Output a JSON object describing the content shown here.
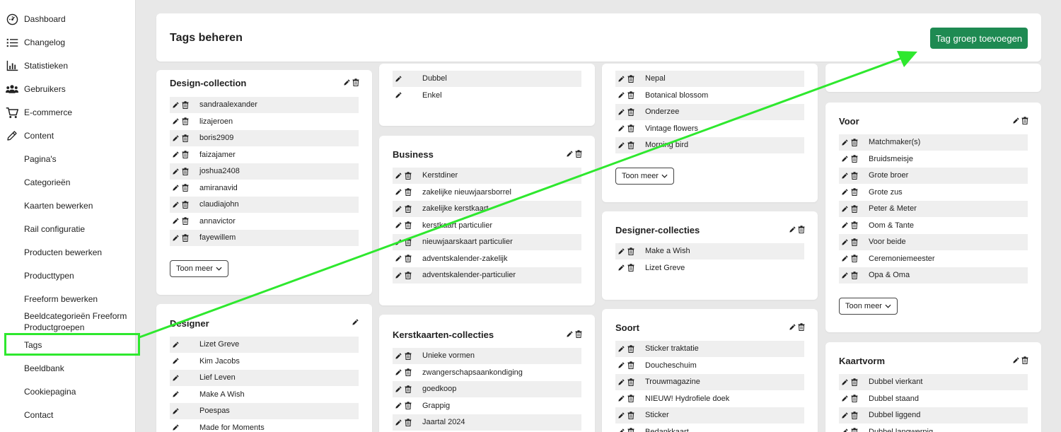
{
  "sidebar": {
    "items": [
      {
        "label": "Dashboard",
        "icon": "dashboard-icon"
      },
      {
        "label": "Changelog",
        "icon": "list-icon"
      },
      {
        "label": "Statistieken",
        "icon": "bar-chart-icon"
      },
      {
        "label": "Gebruikers",
        "icon": "users-icon"
      },
      {
        "label": "E-commerce",
        "icon": "cart-icon"
      },
      {
        "label": "Content",
        "icon": "pencil-icon"
      },
      {
        "label": "Pagina's"
      },
      {
        "label": "Categorieën"
      },
      {
        "label": "Kaarten bewerken"
      },
      {
        "label": "Rail configuratie"
      },
      {
        "label": "Producten bewerken"
      },
      {
        "label": "Producttypen"
      },
      {
        "label": "Freeform bewerken"
      },
      {
        "label": "Beeldcategorieën Freeform Productgroepen"
      },
      {
        "label": "Tags"
      },
      {
        "label": "Beeldbank"
      },
      {
        "label": "Cookiepagina"
      },
      {
        "label": "Contact"
      }
    ]
  },
  "header": {
    "title": "Tags beheren",
    "add_label": "Tag groep toevoegen"
  },
  "colors": {
    "accent": "#1e8a52",
    "highlight": "#2ee82e"
  },
  "cards": {
    "design_collection": {
      "title": "Design-collection",
      "items": [
        "sandraalexander",
        "lizajeroen",
        "boris2909",
        "faizajamer",
        "joshua2408",
        "amiranavid",
        "claudiajohn",
        "annavictor",
        "fayewillem"
      ],
      "more": "Toon meer"
    },
    "designer": {
      "title": "Designer",
      "items": [
        "Lizet Greve",
        "Kim Jacobs",
        "Lief Leven",
        "Make A Wish",
        "Poespas",
        "Made for Moments"
      ]
    },
    "col2_top": {
      "items": [
        "Dubbel",
        "Enkel"
      ]
    },
    "business": {
      "title": "Business",
      "items": [
        "Kerstdiner",
        "zakelijke nieuwjaarsborrel",
        "zakelijke kerstkaart",
        "kerstkaart particulier",
        "nieuwjaarskaart particulier",
        "adventskalender-zakelijk",
        "adventskalender-particulier"
      ]
    },
    "kerstkaarten": {
      "title": "Kerstkaarten-collecties",
      "items": [
        "Unieke vormen",
        "zwangerschapsaankondiging",
        "goedkoop",
        "Grappig",
        "Jaartal 2024"
      ]
    },
    "col3_top": {
      "items": [
        "Nepal",
        "Botanical blossom",
        "Onderzee",
        "Vintage flowers",
        "Morning bird"
      ],
      "more": "Toon meer"
    },
    "designer_collecties": {
      "title": "Designer-collecties",
      "items": [
        "Make a Wish",
        "Lizet Greve"
      ]
    },
    "soort": {
      "title": "Soort",
      "items": [
        "Sticker traktatie",
        "Doucheschuim",
        "Trouwmagazine",
        "NIEUW! Hydrofiele doek",
        "Sticker",
        "Bedankkaart"
      ]
    },
    "voor": {
      "title": "Voor",
      "items": [
        "Matchmaker(s)",
        "Bruidsmeisje",
        "Grote broer",
        "Grote zus",
        "Peter & Meter",
        "Oom & Tante",
        "Voor beide",
        "Ceremoniemeester",
        "Opa & Oma"
      ],
      "more": "Toon meer"
    },
    "kaartvorm": {
      "title": "Kaartvorm",
      "items": [
        "Dubbel vierkant",
        "Dubbel staand",
        "Dubbel liggend",
        "Dubbel langwerpig"
      ]
    }
  }
}
